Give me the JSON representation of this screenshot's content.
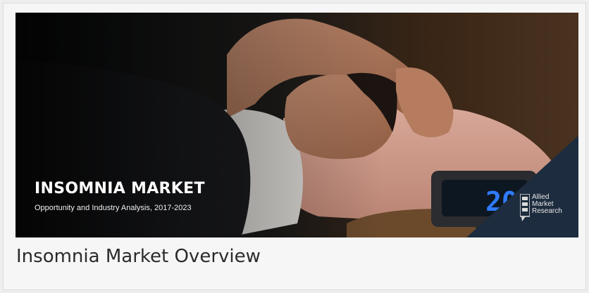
{
  "banner": {
    "title": "INSOMNIA MARKET",
    "subtitle": "Opportunity and Industry Analysis, 2017-2023",
    "clock_display": "20",
    "logo": {
      "line1": "Allied",
      "line2": "Market",
      "line3": "Research"
    }
  },
  "caption": "Insomnia Market Overview",
  "colors": {
    "clock_digits": "#2f7bff",
    "corner_triangle": "#1d2c3e",
    "pillow": "#e3b3a2"
  }
}
